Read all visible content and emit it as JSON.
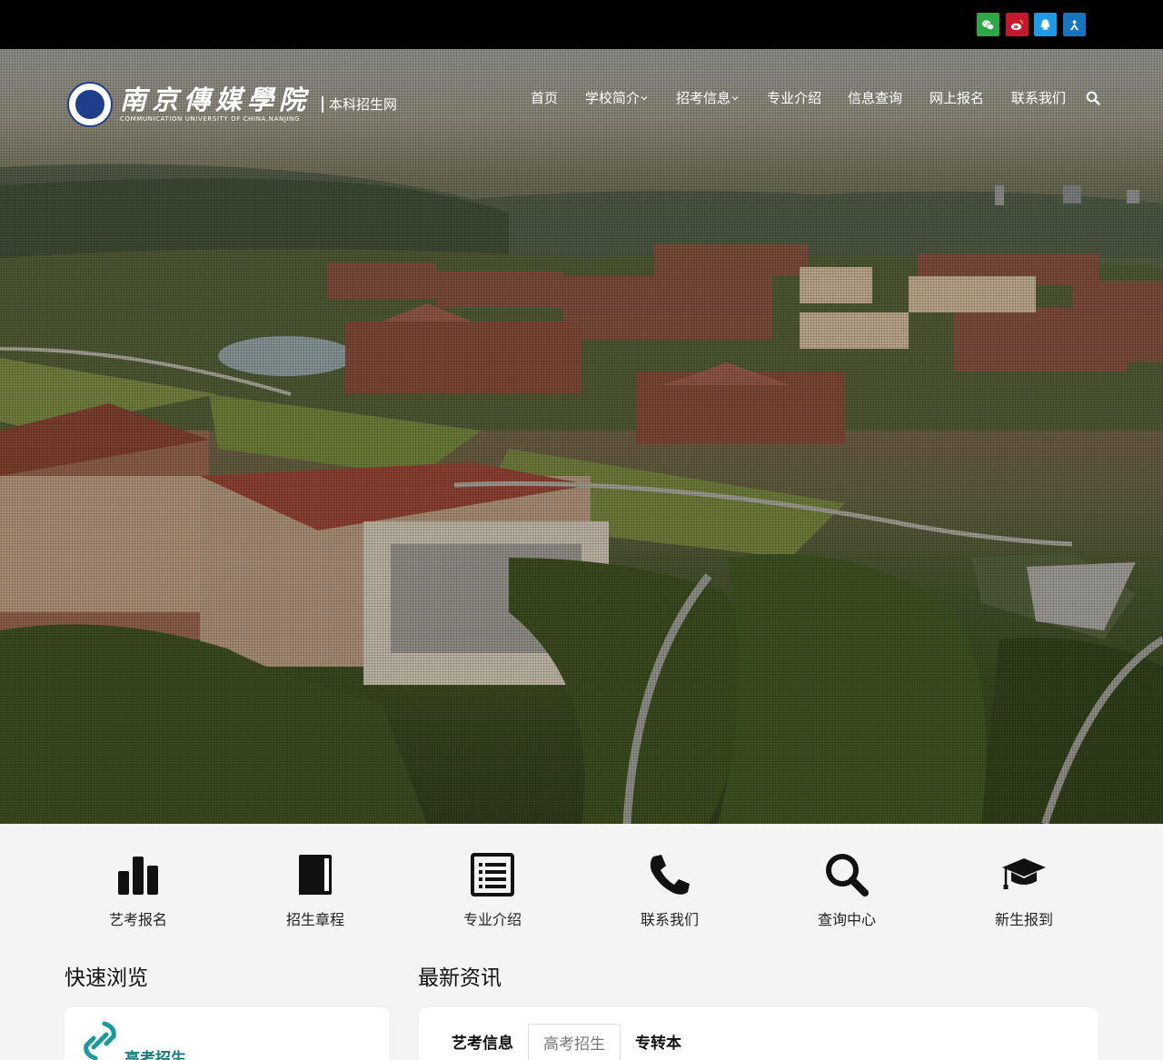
{
  "social": {
    "items": [
      {
        "name": "wechat-icon",
        "color": "#2aa944"
      },
      {
        "name": "weibo-icon",
        "color": "#c7162e"
      },
      {
        "name": "qq-icon",
        "color": "#1e9be6"
      },
      {
        "name": "app-icon",
        "color": "#1774c0"
      }
    ]
  },
  "logo": {
    "cn": "南京傳媒學院",
    "en": "COMMUNICATION UNIVERSITY OF CHINA,NANJING",
    "sub": "本科招生网"
  },
  "nav": {
    "items": [
      {
        "label": "首页",
        "dropdown": false
      },
      {
        "label": "学校简介",
        "dropdown": true
      },
      {
        "label": "招考信息",
        "dropdown": true
      },
      {
        "label": "专业介绍",
        "dropdown": false
      },
      {
        "label": "信息查询",
        "dropdown": false
      },
      {
        "label": "网上报名",
        "dropdown": false
      },
      {
        "label": "联系我们",
        "dropdown": false
      }
    ],
    "search_icon": "search-icon"
  },
  "quick_links": [
    {
      "label": "艺考报名",
      "icon": "bar-chart-icon"
    },
    {
      "label": "招生章程",
      "icon": "book-icon"
    },
    {
      "label": "专业介绍",
      "icon": "list-icon"
    },
    {
      "label": "联系我们",
      "icon": "phone-icon"
    },
    {
      "label": "查询中心",
      "icon": "search-icon"
    },
    {
      "label": "新生报到",
      "icon": "graduation-cap-icon"
    }
  ],
  "quick_browse": {
    "title": "快速浏览",
    "item_label": "高考招生",
    "item_color": "#1a9a9a"
  },
  "news": {
    "title": "最新资讯",
    "tabs": [
      {
        "label": "艺考信息",
        "active": false
      },
      {
        "label": "高考招生",
        "active": true
      },
      {
        "label": "专转本",
        "active": false
      }
    ]
  }
}
